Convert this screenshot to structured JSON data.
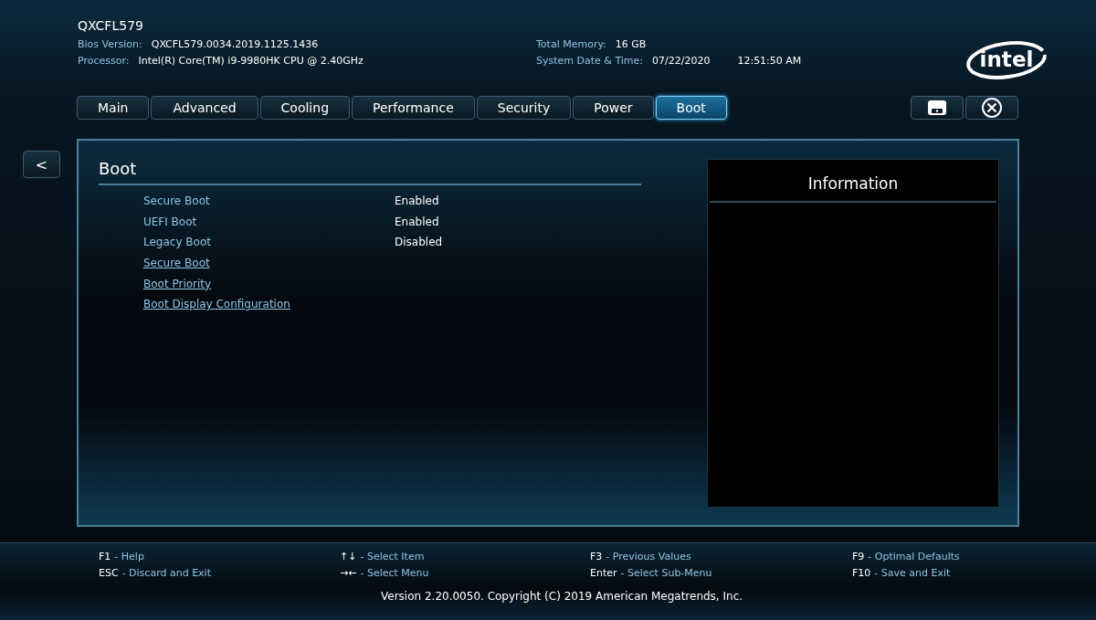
{
  "header": {
    "model": "QXCFL579",
    "info_left": [
      {
        "label": "Bios Version:",
        "value": "QXCFL579.0034.2019.1125.1436"
      },
      {
        "label": "Processor:",
        "value": "Intel(R) Core(TM) i9-9980HK CPU @ 2.40GHz"
      }
    ],
    "memory": {
      "label": "Total Memory:",
      "value": "16 GB"
    },
    "datetime": {
      "label": "System Date & Time:",
      "date": "07/22/2020",
      "time": "12:51:50 AM"
    },
    "logo": "intel"
  },
  "tabs": [
    {
      "label": "Main",
      "selected": false
    },
    {
      "label": "Advanced",
      "selected": false
    },
    {
      "label": "Cooling",
      "selected": false
    },
    {
      "label": "Performance",
      "selected": false
    },
    {
      "label": "Security",
      "selected": false
    },
    {
      "label": "Power",
      "selected": false
    },
    {
      "label": "Boot",
      "selected": true
    }
  ],
  "back_button": "<",
  "panel": {
    "title": "Boot",
    "items": [
      {
        "kind": "setting",
        "label": "Secure Boot",
        "value": "Enabled"
      },
      {
        "kind": "setting",
        "label": "UEFI Boot",
        "value": "Enabled"
      },
      {
        "kind": "setting",
        "label": "Legacy Boot",
        "value": "Disabled"
      },
      {
        "kind": "link",
        "label": "Secure Boot"
      },
      {
        "kind": "link",
        "label": "Boot Priority"
      },
      {
        "kind": "link",
        "label": "Boot Display Configuration"
      }
    ]
  },
  "information": {
    "title": "Information"
  },
  "help": [
    [
      {
        "key": "F1",
        "action": "- Help"
      },
      {
        "key": "ESC",
        "action": "- Discard and Exit"
      }
    ],
    [
      {
        "key": "↑↓",
        "action": "- Select Item"
      },
      {
        "key": "→←",
        "action": "- Select Menu"
      }
    ],
    [
      {
        "key": "F3",
        "action": "- Previous Values"
      },
      {
        "key": "Enter",
        "action": "- Select Sub-Menu"
      }
    ],
    [
      {
        "key": "F9",
        "action": "- Optimal Defaults"
      },
      {
        "key": "F10",
        "action": "- Save and Exit"
      }
    ]
  ],
  "copyright": "Version 2.20.0050. Copyright (C) 2019 American Megatrends, Inc."
}
